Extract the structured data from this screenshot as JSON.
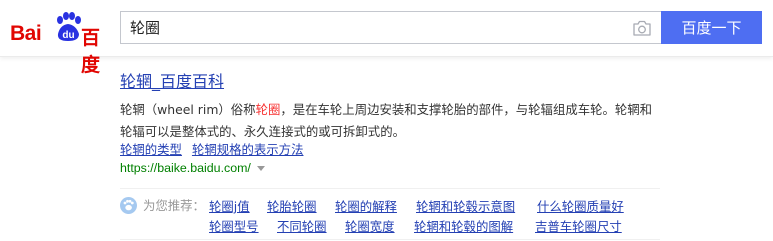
{
  "logo": {
    "text_bai": "Bai",
    "text_du": "du",
    "text_cn": "百度"
  },
  "search": {
    "query": "轮圈",
    "button_label": "百度一下"
  },
  "result": {
    "title": "轮辋_百度百科",
    "abstract_pre": "轮辋（wheel rim）俗称",
    "abstract_em": "轮圈",
    "abstract_post": "，是在车轮上周边安装和支撑轮胎的部件，与轮辐组成车轮。轮辋和轮辐可以是整体式的、永久连接式的或可拆卸式的。",
    "sublinks": [
      "轮辋的类型",
      "轮辋规格的表示方法"
    ],
    "url": "https://baike.baidu.com/"
  },
  "recommend": {
    "label": "为您推荐：",
    "row1": [
      "轮圈j值",
      "轮胎轮圈",
      "轮圈的解释",
      "轮辋和轮毂示意图",
      "什么轮圈质量好"
    ],
    "row2": [
      "轮圈型号",
      "不同轮圈",
      "轮圈宽度",
      "轮辋和轮毂的图解",
      "吉普车轮圈尺寸"
    ]
  },
  "colors": {
    "brand_red": "#e10602",
    "brand_blue": "#2932e1",
    "button_blue": "#4e6ef2",
    "link_blue": "#2440b3",
    "url_green": "#008000",
    "highlight_red": "#f73131"
  }
}
